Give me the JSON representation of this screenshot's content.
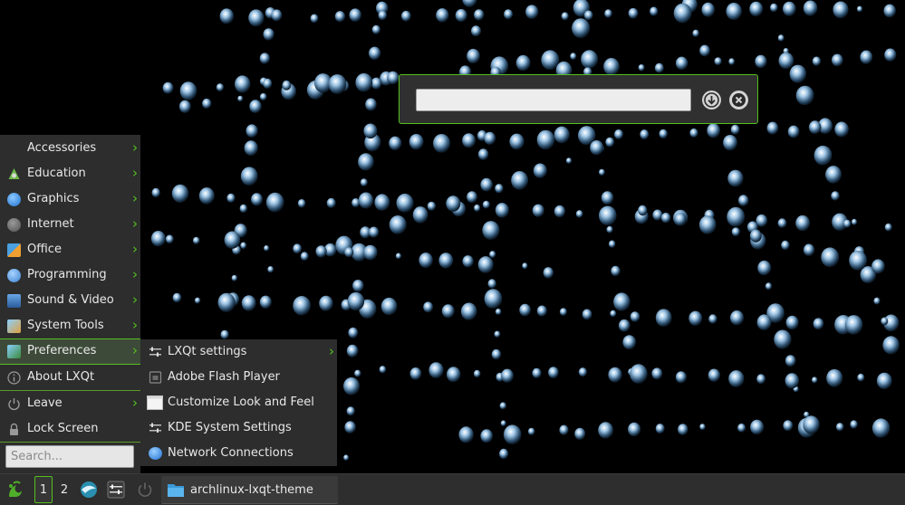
{
  "run_dialog": {
    "input_value": "",
    "history_icon": "download-arrow-icon",
    "close_icon": "close-x-icon"
  },
  "main_menu": {
    "items": [
      {
        "label": "Accessories",
        "icon": "accessories-icon",
        "submenu": true
      },
      {
        "label": "Education",
        "icon": "education-icon",
        "submenu": true
      },
      {
        "label": "Graphics",
        "icon": "graphics-icon",
        "submenu": true
      },
      {
        "label": "Internet",
        "icon": "internet-globe-icon",
        "submenu": true
      },
      {
        "label": "Office",
        "icon": "office-icon",
        "submenu": true
      },
      {
        "label": "Programming",
        "icon": "programming-icon",
        "submenu": true
      },
      {
        "label": "Sound & Video",
        "icon": "sound-video-icon",
        "submenu": true
      },
      {
        "label": "System Tools",
        "icon": "system-tools-icon",
        "submenu": true
      },
      {
        "label": "Preferences",
        "icon": "preferences-icon",
        "submenu": true,
        "selected": true
      },
      {
        "label": "About LXQt",
        "icon": "info-icon",
        "submenu": false
      },
      {
        "label": "Leave",
        "icon": "power-icon",
        "submenu": true
      },
      {
        "label": "Lock Screen",
        "icon": "lock-icon",
        "submenu": false
      }
    ],
    "search_placeholder": "Search..."
  },
  "preferences_submenu": {
    "items": [
      {
        "label": "LXQt settings",
        "icon": "settings-sliders-icon",
        "submenu": true
      },
      {
        "label": "Adobe Flash Player",
        "icon": "flash-player-icon",
        "submenu": false
      },
      {
        "label": "Customize Look and Feel",
        "icon": "window-icon",
        "submenu": false
      },
      {
        "label": "KDE System Settings",
        "icon": "settings-sliders-icon",
        "submenu": false
      },
      {
        "label": "Network Connections",
        "icon": "network-globe-icon",
        "submenu": false
      }
    ]
  },
  "taskbar": {
    "start_icon": "lxqt-logo-icon",
    "desktops": [
      "1",
      "2"
    ],
    "active_desktop": "1",
    "quicklaunch_icons": [
      "browser-icon",
      "settings-sliders-icon",
      "power-icon"
    ],
    "task": {
      "label": "archlinux-lxqt-theme",
      "icon": "folder-icon"
    }
  },
  "colors": {
    "accent": "#55c020",
    "panel": "#2c2d2c",
    "desktop": "#000000"
  }
}
